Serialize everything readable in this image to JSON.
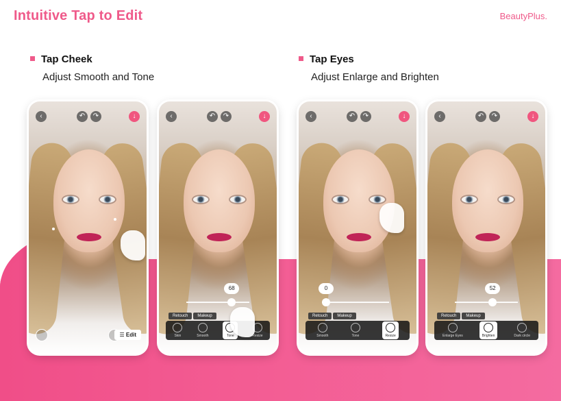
{
  "header": {
    "title": "Intuitive Tap to Edit",
    "brand": "BeautyPlus."
  },
  "sections": [
    {
      "title": "Tap Cheek",
      "subtitle": "Adjust Smooth and Tone"
    },
    {
      "title": "Tap Eyes",
      "subtitle": "Adjust Enlarge and Brighten"
    }
  ],
  "tabs": {
    "retouch": "Retouch",
    "makeup": "Makeup"
  },
  "phones": [
    {
      "edit_label": "Edit"
    },
    {
      "slider_value": "68",
      "slider_fraction": 0.72,
      "tools": [
        "Skin",
        "Smooth",
        "Tone",
        "Resize"
      ],
      "selected": 2
    },
    {
      "slider_value": "0",
      "slider_fraction": 0.0,
      "tools": [
        "Smooth",
        "Tone",
        "Resize"
      ],
      "selected": 2
    },
    {
      "slider_value": "52",
      "slider_fraction": 0.6,
      "tools": [
        "Enlarge Eyes",
        "Brighten",
        "Dark circle"
      ],
      "selected": 1
    }
  ],
  "icons": [
    "back-icon",
    "undo-icon",
    "redo-icon",
    "download-icon",
    "tap-hand-icon",
    "edit-sliders-icon",
    "compare-icon",
    "crop-icon"
  ],
  "colors": {
    "accent": "#ef5a8a",
    "band": "#f04e88"
  }
}
